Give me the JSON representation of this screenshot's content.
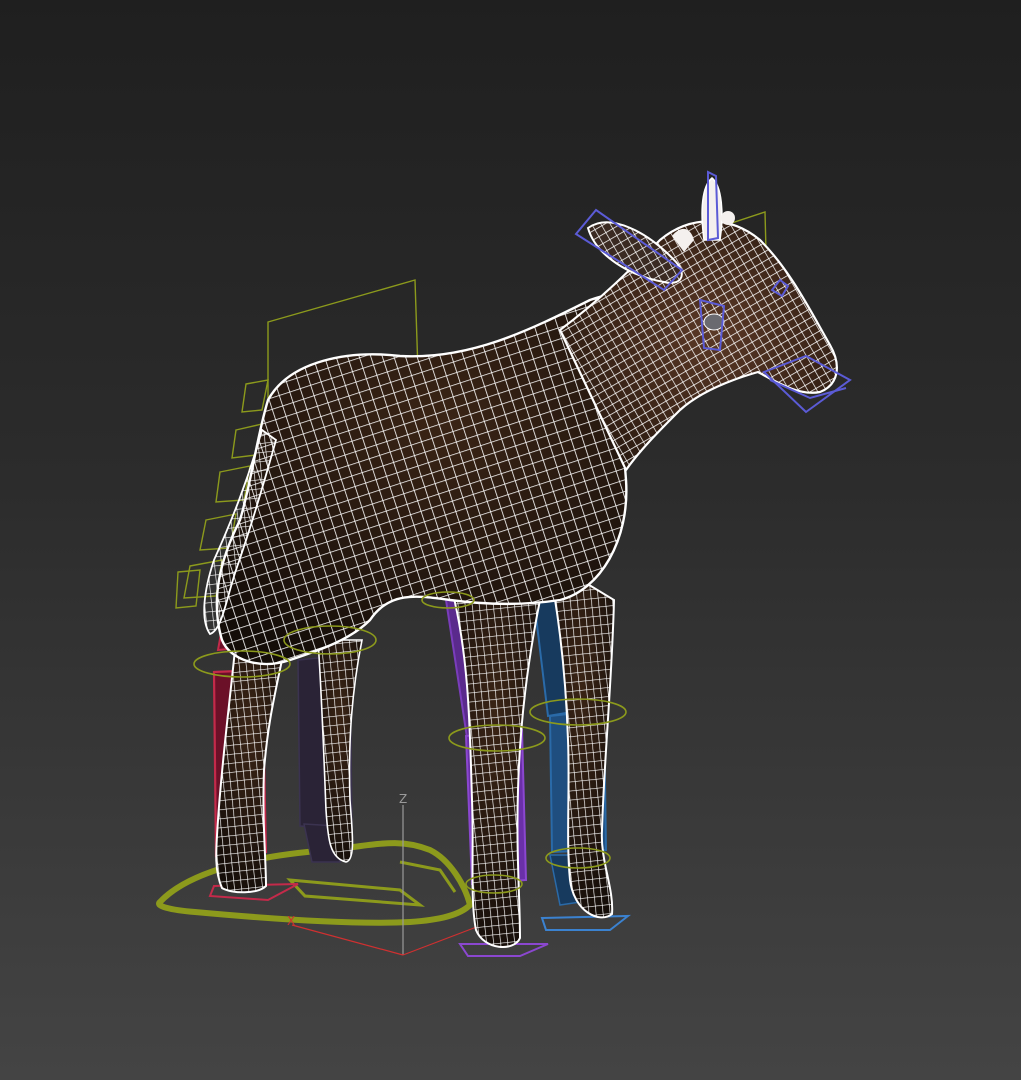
{
  "viewport": {
    "axis_labels": {
      "z": "Z",
      "x": "X"
    }
  },
  "colors": {
    "background_top": "#1f1f1f",
    "background_bottom": "#444444",
    "mesh_wire": "#ffffff",
    "helper_green": "#8c9a1c",
    "bone_red": "#c42a4a",
    "bone_dark": "#2a2336",
    "bone_purple": "#7a3dbb",
    "bone_blue": "#1f4e7f",
    "control_blue": "#5b5bd6",
    "axis_x": "#d03030",
    "axis_z": "#9a9a9a"
  },
  "icons": [
    "giraffe-wireframe-mesh",
    "rig-root-controller",
    "axis-gizmo"
  ]
}
